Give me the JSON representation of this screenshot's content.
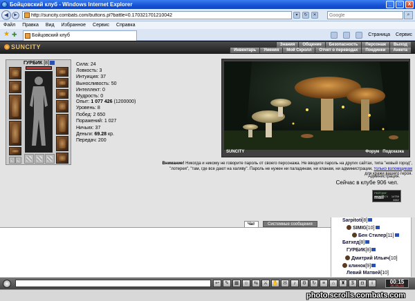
{
  "window": {
    "title": "Бойцовский клуб - Windows Internet Explorer",
    "min": "_",
    "max": "□",
    "close": "X"
  },
  "address": {
    "url": "http://suncity.combats.com/buttons.pl?battle=0.170321701210042",
    "search_placeholder": "Google"
  },
  "menu": [
    "Файл",
    "Правка",
    "Вид",
    "Избранное",
    "Сервис",
    "Справка"
  ],
  "tab": {
    "label": "Бойцовский клуб"
  },
  "commands": {
    "page": "Страница",
    "tools": "Сервис"
  },
  "game": {
    "logo": "SUNCITY",
    "nav_top": [
      "Знания",
      "Общение",
      "Безопасность",
      "Персонаж",
      "Выход"
    ],
    "nav_bottom": [
      "Инвентарь",
      "Умения",
      "Мой Скролл",
      "Отчет о переводах",
      "Поединки",
      "Анкета"
    ],
    "character": {
      "name": "ГУРБИК",
      "level": "[8]",
      "hp": "632/632",
      "hp_fraction": 1.0,
      "stats": [
        "Сила: 24",
        "Ловкость: 3",
        "Интуиция: 37",
        "Выносливость: 50",
        "Интеллект: 0",
        "Мудрость: 0"
      ],
      "experience_label": "Опыт:",
      "experience_value": "1 077 426",
      "experience_next": "(1200000)",
      "level_line": "Уровень: 8",
      "wins": "Побед: 2 650",
      "losses": "Поражений: 1 027",
      "draws": "Ничьих: 37",
      "money_label": "Деньги:",
      "money_value": "69.28",
      "money_unit": "кр.",
      "transfers": "Передач: 200"
    },
    "scene": {
      "logo": "SUNCITY",
      "links": [
        "Форум",
        "Подсказка"
      ]
    },
    "warning": {
      "bold": "Внимание!",
      "text": "Никогда и никому не говорите пароль от своего персонажа. Не вводите пароль на других сайтах, типа \"новый город\", \"лотерея\", \"там, где все дают на халяву\". Пароль не нужен ни паладинам, ни кланам, ни администрации,",
      "link": "только взломщикам",
      "tail": "для кражи вашего героя.",
      "admin": "Администрация."
    },
    "club_count": "Сейчас в клубе 906 чел.",
    "counter": {
      "line1": "РЕЙТИНГ 060094474",
      "logo": "mail",
      "n1": "14759",
      "n2": "4662"
    },
    "chat_tabs": {
      "chat": "Чат",
      "system": "Системные сообщения"
    },
    "users": [
      {
        "name": "Sarpitoti",
        "level": "[8]"
      },
      {
        "name": "SIMIG",
        "level": "[10]"
      },
      {
        "name": "Бен Стилер",
        "level": "[11]"
      },
      {
        "name": "Батхед",
        "level": "[8]"
      },
      {
        "name": "ГУРБИК",
        "level": "[8]"
      },
      {
        "name": "Дмитрий Ильич",
        "level": "[10]"
      },
      {
        "name": "клинок",
        "level": "[9]"
      },
      {
        "name": "Левий Матвей",
        "level": "[10]"
      }
    ],
    "clock": {
      "time": "00:15",
      "date": "26.05.09"
    }
  },
  "watermark": "photo.scrolls.combats.com"
}
